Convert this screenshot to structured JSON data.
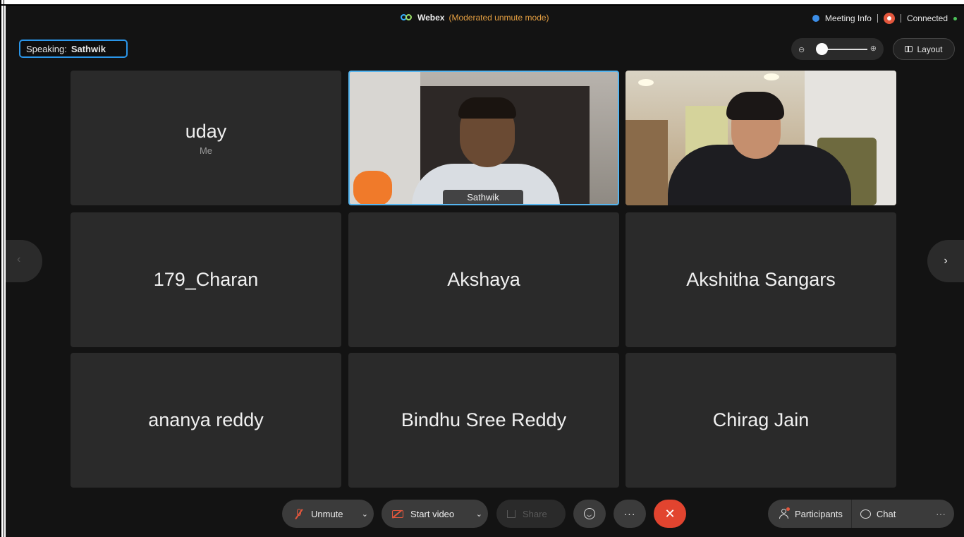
{
  "titlebar": {
    "app_name": "Webex",
    "mode": "(Moderated unmute mode)",
    "meeting_info": "Meeting Info",
    "status": "Connected"
  },
  "speaking": {
    "prefix": "Speaking:",
    "name": "Sathwik"
  },
  "layout_button": "Layout",
  "tiles": [
    {
      "name": "uday",
      "sub": "Me",
      "video": false
    },
    {
      "name": "Sathwik",
      "video": true,
      "active": true
    },
    {
      "name": "",
      "video": true
    },
    {
      "name": "179_Charan",
      "video": false
    },
    {
      "name": "Akshaya",
      "video": false
    },
    {
      "name": "Akshitha Sangars",
      "video": false
    },
    {
      "name": "ananya reddy",
      "video": false
    },
    {
      "name": "Bindhu Sree Reddy",
      "video": false
    },
    {
      "name": "Chirag Jain",
      "video": false
    }
  ],
  "toolbar": {
    "unmute_label": "Unmute",
    "start_video_label": "Start video",
    "share_label": "Share",
    "participants_label": "Participants",
    "chat_label": "Chat"
  },
  "icons": {
    "prev": "‹",
    "next": "›",
    "leave": "✕",
    "more": "···",
    "caret": "⌄"
  },
  "colors": {
    "accent": "#2a95e8",
    "leave": "#e2442f",
    "mode": "#e6a042",
    "connected": "#4cc35a"
  }
}
